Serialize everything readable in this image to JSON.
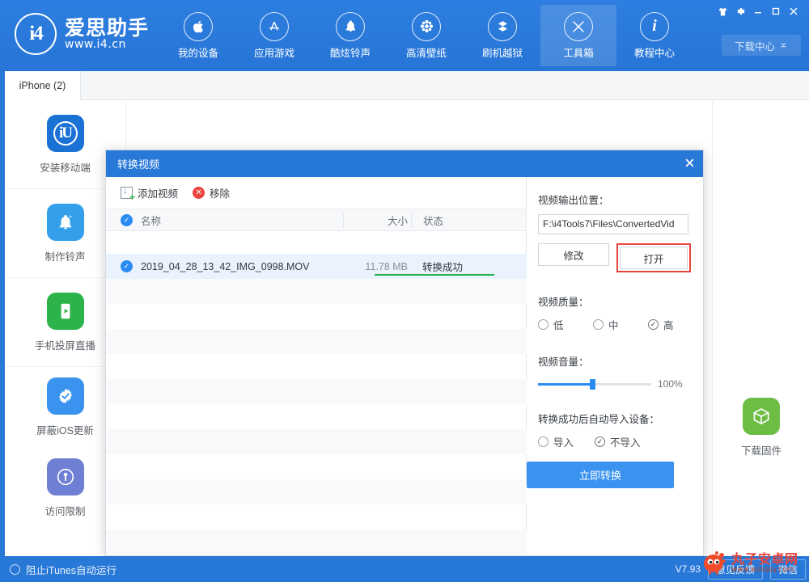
{
  "header": {
    "logo": {
      "mark": "i4",
      "cn": "爱思助手",
      "url": "www.i4.cn"
    },
    "nav": [
      {
        "label": "我的设备",
        "icon": "apple-icon",
        "active": false
      },
      {
        "label": "应用游戏",
        "icon": "appstore-icon",
        "active": false
      },
      {
        "label": "酷炫铃声",
        "icon": "bell-icon",
        "active": false
      },
      {
        "label": "高清壁纸",
        "icon": "flower-icon",
        "active": false
      },
      {
        "label": "刷机越狱",
        "icon": "dropbox-icon",
        "active": false
      },
      {
        "label": "工具箱",
        "icon": "tools-icon",
        "active": true
      },
      {
        "label": "教程中心",
        "icon": "info-icon",
        "active": false
      }
    ],
    "window_buttons": [
      "skin-icon",
      "gear-icon",
      "minimize-icon",
      "maximize-icon",
      "close-icon"
    ],
    "download_center": "下载中心"
  },
  "tabs": [
    {
      "label": "iPhone (2)",
      "active": true
    }
  ],
  "sidebar": {
    "items": [
      {
        "label": "安装移动端",
        "icon": "i4-app-icon",
        "color": "#1a73d4"
      },
      {
        "label": "制作铃声",
        "icon": "bell-icon",
        "color": "#34a0ec"
      },
      {
        "label": "手机投屏直播",
        "icon": "screen-cast-icon",
        "color": "#2cb34a"
      },
      {
        "label": "屏蔽iOS更新",
        "icon": "block-update-icon",
        "color": "#3a94ef"
      },
      {
        "label": "访问限制",
        "icon": "lock-key-icon",
        "color": "#6f7fd4"
      }
    ]
  },
  "right_rail": {
    "items": [
      {
        "label": "下载固件",
        "icon": "firmware-box-icon",
        "color": "#6dbd45"
      }
    ]
  },
  "dialog": {
    "title": "转换视频",
    "close": "×",
    "toolbar": {
      "add_video": "添加视频",
      "remove": "移除"
    },
    "list": {
      "columns": {
        "name": "名称",
        "size": "大小",
        "status": "状态"
      },
      "rows": [
        {
          "name": "2019_04_28_13_42_IMG_0998.MOV",
          "size": "11.78 MB",
          "status": "转换成功",
          "checked": true,
          "progress": 100
        }
      ]
    },
    "output": {
      "label": "视频输出位置：",
      "path": "F:\\i4Tools7\\Files\\ConvertedVid",
      "modify_button": "修改",
      "open_button": "打开"
    },
    "quality": {
      "label": "视频质量：",
      "options": [
        {
          "label": "低",
          "selected": false
        },
        {
          "label": "中",
          "selected": false
        },
        {
          "label": "高",
          "selected": true
        }
      ]
    },
    "volume": {
      "label": "视频音量：",
      "value": "100%",
      "percent": 100
    },
    "auto_import": {
      "label": "转换成功后自动导入设备：",
      "options": [
        {
          "label": "导入",
          "selected": false
        },
        {
          "label": "不导入",
          "selected": true
        }
      ]
    },
    "convert_button": "立即转换"
  },
  "statusbar": {
    "itunes_toggle": "阻止iTunes自动运行",
    "version": "V7.93",
    "feedback": "意见反馈",
    "wechat": "微信"
  },
  "watermark": {
    "name": "丸子安卓网",
    "url": "www.wzsqsy.com"
  },
  "colors": {
    "brand_blue": "#2878d8",
    "accent_blue": "#3a94ef",
    "success_green": "#22b14c",
    "alert_red": "#e8453c"
  }
}
